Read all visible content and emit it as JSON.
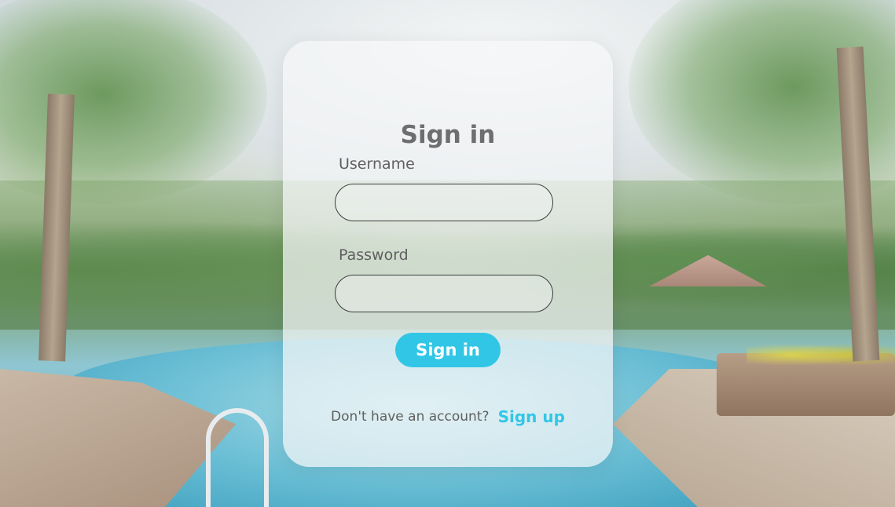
{
  "signin_form": {
    "title": "Sign in",
    "username_label": "Username",
    "username_value": "",
    "password_label": "Password",
    "password_value": "",
    "submit_label": "Sign in",
    "signup_prompt": "Don't have an account?",
    "signup_link": "Sign up"
  },
  "theme": {
    "accent": "#32c6e6",
    "card_background": "#f5f7f8",
    "text_color": "#6e6e6e",
    "input_border": "#3d3d3d"
  }
}
